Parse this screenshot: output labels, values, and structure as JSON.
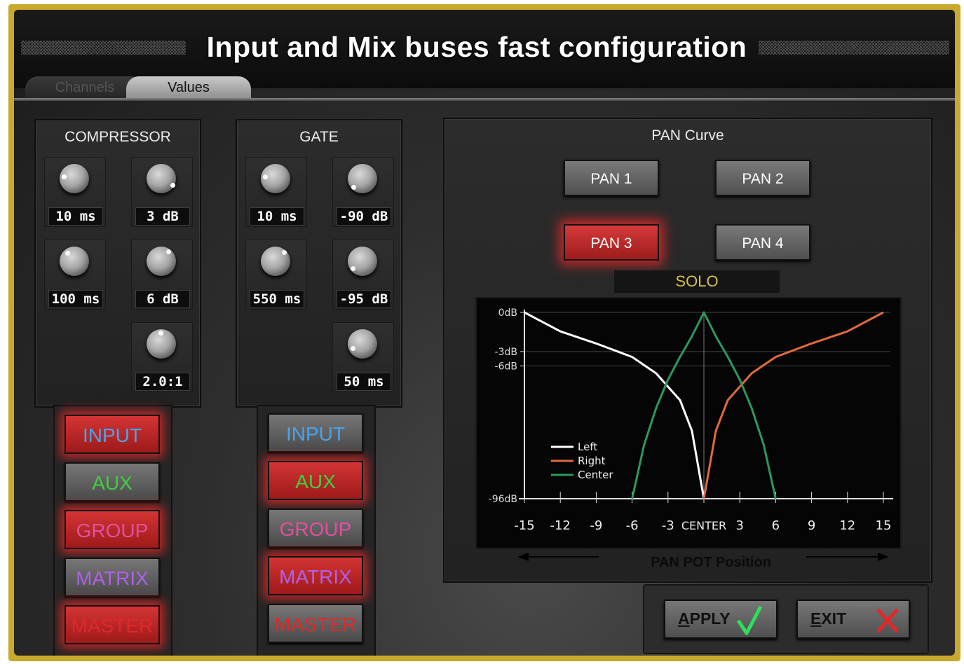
{
  "window": {
    "title": "Input and Mix buses fast configuration",
    "tabs": [
      {
        "label": "Channels",
        "active": false
      },
      {
        "label": "Values",
        "active": true
      }
    ]
  },
  "compressor": {
    "title": "COMPRESSOR",
    "knobs": [
      {
        "value": "10 ms"
      },
      {
        "value": "3 dB"
      },
      {
        "value": "100 ms"
      },
      {
        "value": "6 dB"
      },
      {
        "value": "2.0:1"
      }
    ],
    "buses": [
      {
        "label": "INPUT",
        "active": true,
        "color": "#4aa3e8"
      },
      {
        "label": "AUX",
        "active": false,
        "color": "#40d040"
      },
      {
        "label": "GROUP",
        "active": true,
        "color": "#e050a0"
      },
      {
        "label": "MATRIX",
        "active": false,
        "color": "#b060e8"
      },
      {
        "label": "MASTER",
        "active": true,
        "color": "#e02828"
      }
    ]
  },
  "gate": {
    "title": "GATE",
    "knobs": [
      {
        "value": "10 ms"
      },
      {
        "value": "-90 dB"
      },
      {
        "value": "550 ms"
      },
      {
        "value": "-95 dB"
      },
      {
        "value": "50 ms"
      }
    ],
    "buses": [
      {
        "label": "INPUT",
        "active": false,
        "color": "#4aa3e8"
      },
      {
        "label": "AUX",
        "active": true,
        "color": "#40d040"
      },
      {
        "label": "GROUP",
        "active": false,
        "color": "#e050a0"
      },
      {
        "label": "MATRIX",
        "active": true,
        "color": "#b060e8"
      },
      {
        "label": "MASTER",
        "active": false,
        "color": "#e02828"
      }
    ]
  },
  "pan": {
    "title": "PAN Curve",
    "buttons": [
      {
        "label": "PAN 1",
        "active": false
      },
      {
        "label": "PAN 2",
        "active": false
      },
      {
        "label": "PAN 3",
        "active": true
      },
      {
        "label": "PAN 4",
        "active": false
      }
    ],
    "solo_label": "SOLO",
    "x_axis_label": "PAN POT Position"
  },
  "chart_data": {
    "type": "line",
    "x": [
      -15,
      -12,
      -9,
      -6,
      -3,
      0,
      3,
      6,
      9,
      12,
      15
    ],
    "x_tick_labels": [
      "-15",
      "-12",
      "-9",
      "-6",
      "-3",
      "CENTER",
      "3",
      "6",
      "9",
      "12",
      "15"
    ],
    "y_tick_labels": [
      "0dB",
      "-3dB",
      "-6dB",
      "-96dB"
    ],
    "ylim": [
      -96,
      0
    ],
    "xlim": [
      -15,
      15
    ],
    "legend_position": "bottom-left",
    "series": [
      {
        "name": "Left",
        "color": "#ffffff",
        "x": [
          -15,
          -12,
          -9,
          -6,
          -4,
          -2,
          -1,
          0
        ],
        "y": [
          0,
          -0.6,
          -1.8,
          -4,
          -8,
          -18,
          -35,
          -96
        ]
      },
      {
        "name": "Right",
        "color": "#e06a40",
        "x": [
          0,
          1,
          2,
          4,
          6,
          9,
          12,
          15
        ],
        "y": [
          -96,
          -35,
          -18,
          -8,
          -4,
          -1.8,
          -0.6,
          0
        ]
      },
      {
        "name": "Center",
        "color": "#2a9a5a",
        "x": [
          -6,
          -5,
          -4,
          -3,
          -2,
          -1,
          0,
          1,
          2,
          3,
          4,
          5,
          6
        ],
        "y": [
          -96,
          -45,
          -22,
          -10,
          -4,
          -1,
          0,
          -1,
          -4,
          -10,
          -22,
          -45,
          -96
        ]
      }
    ]
  },
  "actions": {
    "apply_label": "APPLY",
    "exit_label": "EXIT"
  },
  "colors": {
    "frame": "#c9a82c",
    "solo_text": "#d9c24a",
    "active_glow": "#ff2828"
  }
}
